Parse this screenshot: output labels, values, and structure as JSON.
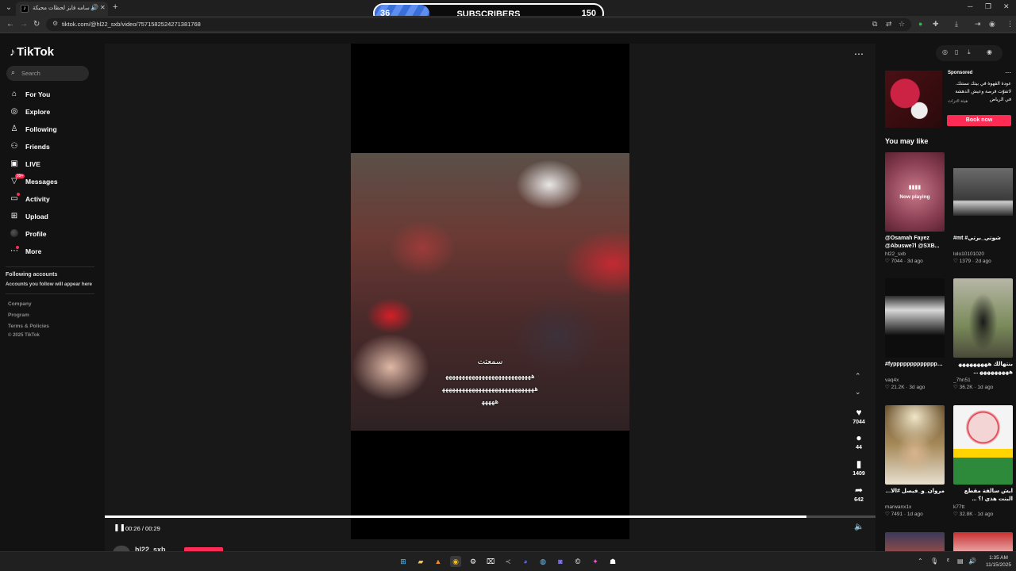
{
  "browser": {
    "tab_title": "اسامه فايز لحظات محبكة ..",
    "new_tab": "+",
    "url": "tiktok.com/@hl22_sxb/video/7571582524271381768",
    "window": {
      "minimize": "─",
      "restore": "❐",
      "close": "✕"
    }
  },
  "overlay": {
    "current": "36",
    "label": "SUBSCRIBERS",
    "goal": "150",
    "progress_fraction": 0.24
  },
  "sidebar": {
    "logo": "TikTok",
    "search_placeholder": "Search",
    "items": [
      {
        "label": "For You",
        "icon": "home-icon"
      },
      {
        "label": "Explore",
        "icon": "compass-icon"
      },
      {
        "label": "Following",
        "icon": "person-icon"
      },
      {
        "label": "Friends",
        "icon": "people-icon"
      },
      {
        "label": "LIVE",
        "icon": "live-icon"
      },
      {
        "label": "Messages",
        "icon": "messages-icon",
        "badge": "99+"
      },
      {
        "label": "Activity",
        "icon": "inbox-icon"
      },
      {
        "label": "Upload",
        "icon": "plus-square-icon"
      },
      {
        "label": "Profile",
        "icon": "avatar-icon"
      },
      {
        "label": "More",
        "icon": "more-icon"
      }
    ],
    "following_title": "Following accounts",
    "following_desc": "Accounts you follow will appear here",
    "footer": [
      "Company",
      "Program",
      "Terms & Policies",
      "© 2025 TikTok"
    ]
  },
  "video": {
    "caption_lines": [
      "سمعتت",
      "ﻫﻬﻬﻬﻬﻬﻬﻬﻬﻬﻬﻬﻬﻬﻬﻬﻬﻬﻬﻬﻬﻬﻬﻬﻬﻬﻬ",
      "ﻫﻬﻬﻬﻬﻬﻬﻬﻬﻬﻬﻬﻬﻬﻬﻬﻬﻬﻬﻬﻬﻬﻬﻬﻬﻬﻬﻬﻬ",
      "ﻫﻬﻬﻬﻬ"
    ],
    "likes": "7044",
    "comments": "44",
    "saves": "1409",
    "shares": "642",
    "time": "00:26 / 00:29",
    "progress_fraction": 0.91,
    "author": "hl22_sxb"
  },
  "right_panel": {
    "sponsored": "Sponsored",
    "ad_text": "عودة القهوة في بيتك نستنك. لاتفوّت فرصة وعيش الدهشة في الرياض",
    "ad_org": "هيئة الترات",
    "ad_button": "Book now",
    "you_may_like": "You may like",
    "now_playing": "Now playing",
    "cards": [
      {
        "desc": "@Osamah Fayez @Abuswe7l @SXB...",
        "user": "hl22_sxb",
        "likes": "7044",
        "ago": "3d ago"
      },
      {
        "desc": "#mt #شوتي_برتي",
        "user": "lolo10101020",
        "likes": "1379",
        "ago": "2d ago"
      },
      {
        "desc": "#fypppppppppppppppppppppp...",
        "user": "vaq4x",
        "likes": "21.2K",
        "ago": "3d ago"
      },
      {
        "desc": "بنتهالك ﻫﻬﻬﻬﻬﻬﻬﻬﻬ ﻫﻬﻬﻬﻬﻬﻬﻬﻬ ...",
        "user": "_7hn51",
        "likes": "36.2K",
        "ago": "1d ago"
      },
      {
        "desc": "مروان_و_فيصل #الامارات#",
        "user": "marwanx1x",
        "likes": "7491",
        "ago": "1d ago"
      },
      {
        "desc": "ايش سالفة مقطع البنت هذي !؟ ... تضحكني وتغدي البنت",
        "user": "k77tt",
        "likes": "32.8K",
        "ago": "1d ago"
      }
    ]
  },
  "taskbar": {
    "time": "1:35 AM",
    "date": "11/15/2025",
    "lang": "ε"
  }
}
